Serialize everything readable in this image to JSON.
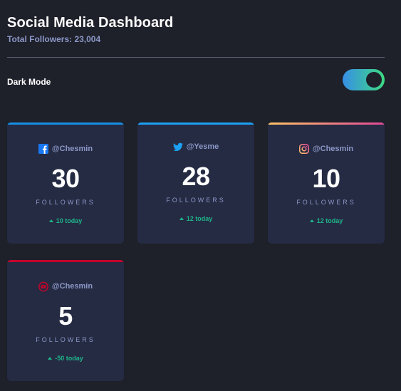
{
  "header": {
    "title": "Social Media Dashboard",
    "total_followers": "Total Followers: 23,004"
  },
  "theme_toggle": {
    "label": "Dark Mode",
    "enabled": true
  },
  "cards": [
    {
      "platform": "facebook",
      "icon": "facebook-icon",
      "accent": "#178fe6",
      "handle": "@Chesmin",
      "count": "30",
      "unit": "FOLLOWERS",
      "change": "10 today"
    },
    {
      "platform": "twitter",
      "icon": "twitter-icon",
      "accent": "#1ca0f2",
      "handle": "@Yesme",
      "count": "28",
      "unit": "FOLLOWERS",
      "change": "12 today"
    },
    {
      "platform": "instagram",
      "icon": "instagram-icon",
      "accent": "#fdc468",
      "handle": "@Chesmin",
      "count": "10",
      "unit": "FOLLOWERS",
      "change": "12 today"
    },
    {
      "platform": "youtube",
      "icon": "youtube-icon",
      "accent": "#c4032a",
      "handle": "@Chesmin",
      "count": "5",
      "unit": "FOLLOWERS",
      "change": "-50 today"
    }
  ]
}
